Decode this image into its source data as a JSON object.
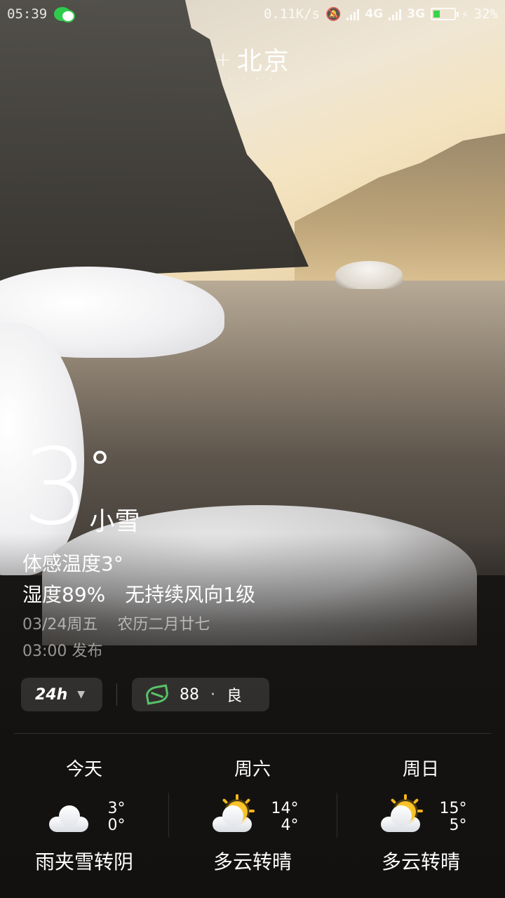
{
  "status_bar": {
    "time": "05:39",
    "net_speed": "0.11K/s",
    "network_1": "4G",
    "network_2": "3G",
    "battery": "32%",
    "battery_level": 0.32,
    "icons": [
      "wechat-icon",
      "bell-muted-icon",
      "signal-icon",
      "battery-icon",
      "charging-icon"
    ]
  },
  "header": {
    "add_label": "+",
    "city": "北京"
  },
  "current": {
    "temperature": "3",
    "degree": "°",
    "condition": "小雪",
    "feels_like": "体感温度3°",
    "humidity": "湿度89%",
    "wind": "无持续风向1级",
    "date": "03/24周五",
    "lunar": "农历二月廿七",
    "published": "03:00 发布"
  },
  "controls": {
    "hours_label": "24h",
    "aqi_value": "88",
    "aqi_sep": "·",
    "aqi_level": "良",
    "aqi_color": "#58c26a"
  },
  "forecast": [
    {
      "day": "今天",
      "high": "3°",
      "low": "0°",
      "desc": "雨夹雪转阴",
      "icon": "cloud-icon"
    },
    {
      "day": "周六",
      "high": "14°",
      "low": "4°",
      "desc": "多云转晴",
      "icon": "partly-sunny-icon"
    },
    {
      "day": "周日",
      "high": "15°",
      "low": "5°",
      "desc": "多云转晴",
      "icon": "partly-sunny-icon"
    }
  ]
}
